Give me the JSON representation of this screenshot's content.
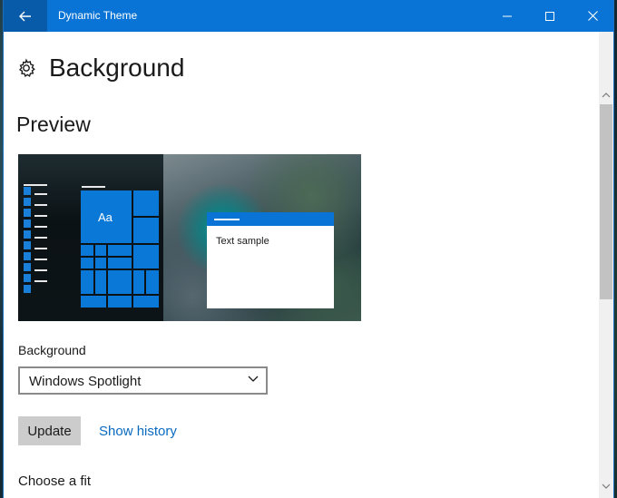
{
  "window": {
    "title": "Dynamic Theme",
    "accent_color": "#0a74d6"
  },
  "header": {
    "icon": "gear-icon",
    "title": "Background"
  },
  "preview": {
    "section_title": "Preview",
    "tile_label": "Aa",
    "sample_text": "Text sample"
  },
  "background_setting": {
    "label": "Background",
    "selected_value": "Windows Spotlight"
  },
  "actions": {
    "update_label": "Update",
    "history_link": "Show history"
  },
  "fit": {
    "label": "Choose a fit"
  }
}
